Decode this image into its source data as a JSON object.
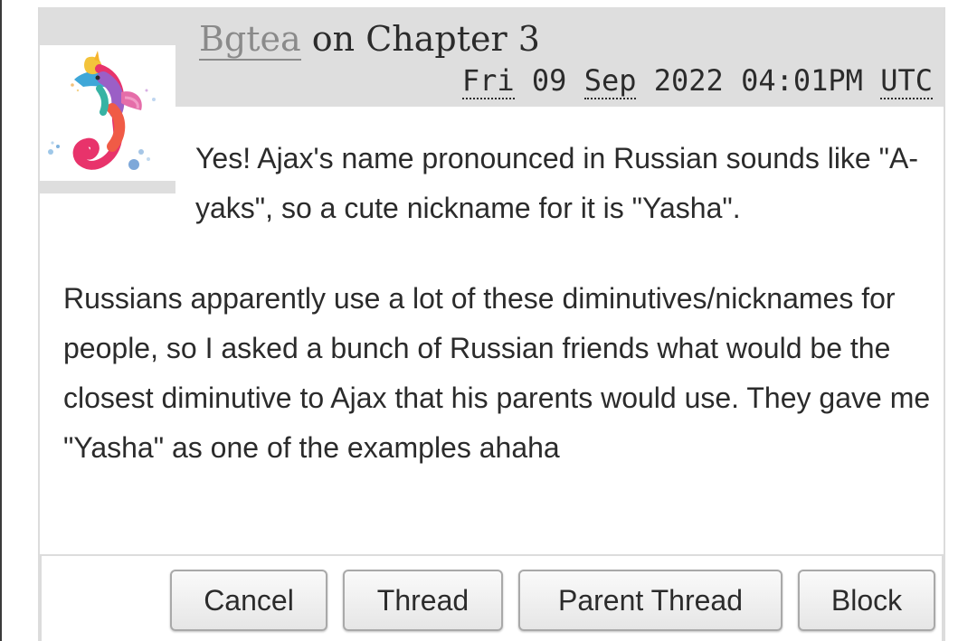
{
  "comment": {
    "author": "Bgtea",
    "on_text": "on",
    "chapter": "Chapter 3",
    "date": {
      "weekday": "Fri",
      "day": "09",
      "month": "Sep",
      "year": "2022",
      "time": "04:01PM",
      "timezone": "UTC"
    },
    "paragraphs": [
      "Yes! Ajax's name pronounced in Russian sounds like \"A-yaks\", so a cute nickname for it is \"Yasha\".",
      "Russians apparently use a lot of these diminutives/nicknames for people, so I asked a bunch of Russian friends what would be the closest diminutive to Ajax that his parents would use. They gave me \"Yasha\" as one of the examples ahaha"
    ]
  },
  "actions": {
    "cancel": "Cancel",
    "thread": "Thread",
    "parent_thread": "Parent Thread",
    "block": "Block"
  },
  "avatar": {
    "icon": "seahorse-watercolor-icon"
  },
  "colors": {
    "header_bg": "#dedede",
    "text": "#2b2b2b",
    "author_link": "#8a8a8a",
    "button_border": "#a9a9a9"
  }
}
